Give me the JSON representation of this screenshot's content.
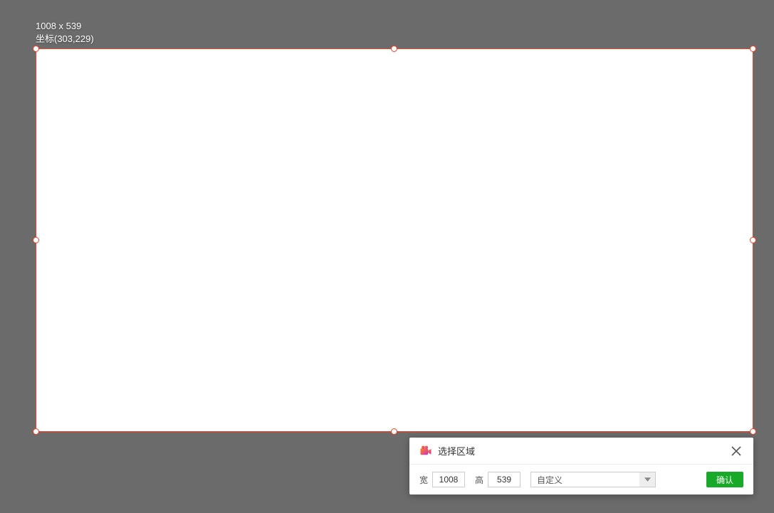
{
  "overlay": {
    "dimensions": "1008 x 539",
    "coordinates": "坐标(303,229)"
  },
  "panel": {
    "title": "选择区域",
    "width_label": "宽",
    "width_value": "1008",
    "height_label": "高",
    "height_value": "539",
    "preset_selected": "自定义",
    "confirm_label": "确认"
  }
}
